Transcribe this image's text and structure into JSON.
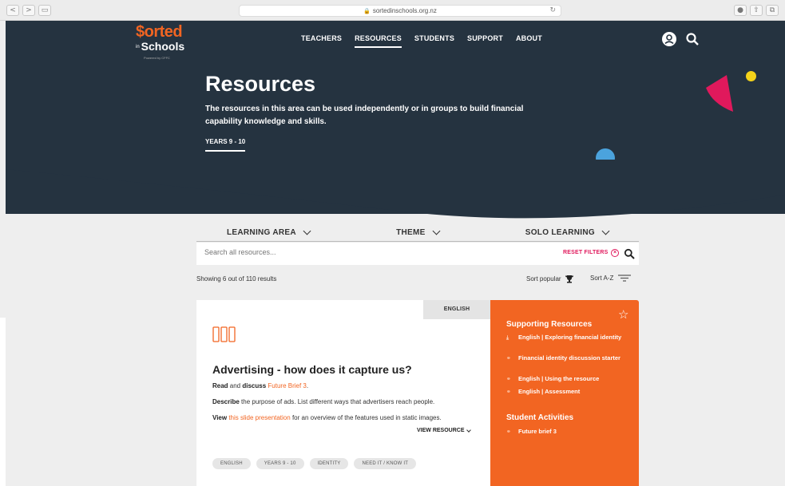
{
  "browser": {
    "url": "sortedinschools.org.nz",
    "back": "<",
    "forward": ">",
    "reload": "↻"
  },
  "logo": {
    "sorted": "$orted",
    "in": "in",
    "schools": "Schools",
    "powered": "Powered by CFFC"
  },
  "nav": {
    "teachers": "TEACHERS",
    "resources": "RESOURCES",
    "students": "STUDENTS",
    "support": "SUPPORT",
    "about": "ABOUT"
  },
  "hero": {
    "title": "Resources",
    "description": "The resources in this area can be used independently or in groups to build financial capability knowledge and skills.",
    "tag": "YEARS 9 - 10"
  },
  "filters": {
    "learning_area": "LEARNING AREA",
    "theme": "THEME",
    "solo": "SOLO LEARNING"
  },
  "search": {
    "placeholder": "Search all resources...",
    "reset": "RESET FILTERS"
  },
  "results": {
    "count_text": "Showing 6 out of 110 results",
    "sort_popular": "Sort popular",
    "sort_az": "Sort A-Z"
  },
  "card": {
    "tag": "ENGLISH",
    "title": "Advertising - how does it capture us?",
    "line1_a": "Read",
    "line1_b": " and ",
    "line1_c": "discuss",
    "line1_d": " ",
    "line1_link": "Future Brief 3",
    "line1_e": ".",
    "line2_a": "Describe",
    "line2_b": " the purpose of ads. List different ways that advertisers reach people.",
    "line3_a": "View",
    "line3_b": " ",
    "line3_link": "this slide presentation",
    "line3_c": " for an overview of the features used in static images.",
    "view_resource": "VIEW RESOURCE",
    "pills": [
      "ENGLISH",
      "YEARS 9 - 10",
      "IDENTITY",
      "NEED IT / KNOW IT"
    ]
  },
  "side": {
    "supporting_title": "Supporting Resources",
    "supporting": [
      "English | Exploring financial identity",
      "Financial identity discussion starter",
      "English | Using the resource",
      "English | Assessment"
    ],
    "activities_title": "Student Activities",
    "activities": [
      "Future brief 3"
    ]
  },
  "colors": {
    "navy": "#253340",
    "orange": "#f26522",
    "pink": "#e0195c",
    "yellow": "#f5d31a",
    "blue": "#4ba3dd"
  }
}
